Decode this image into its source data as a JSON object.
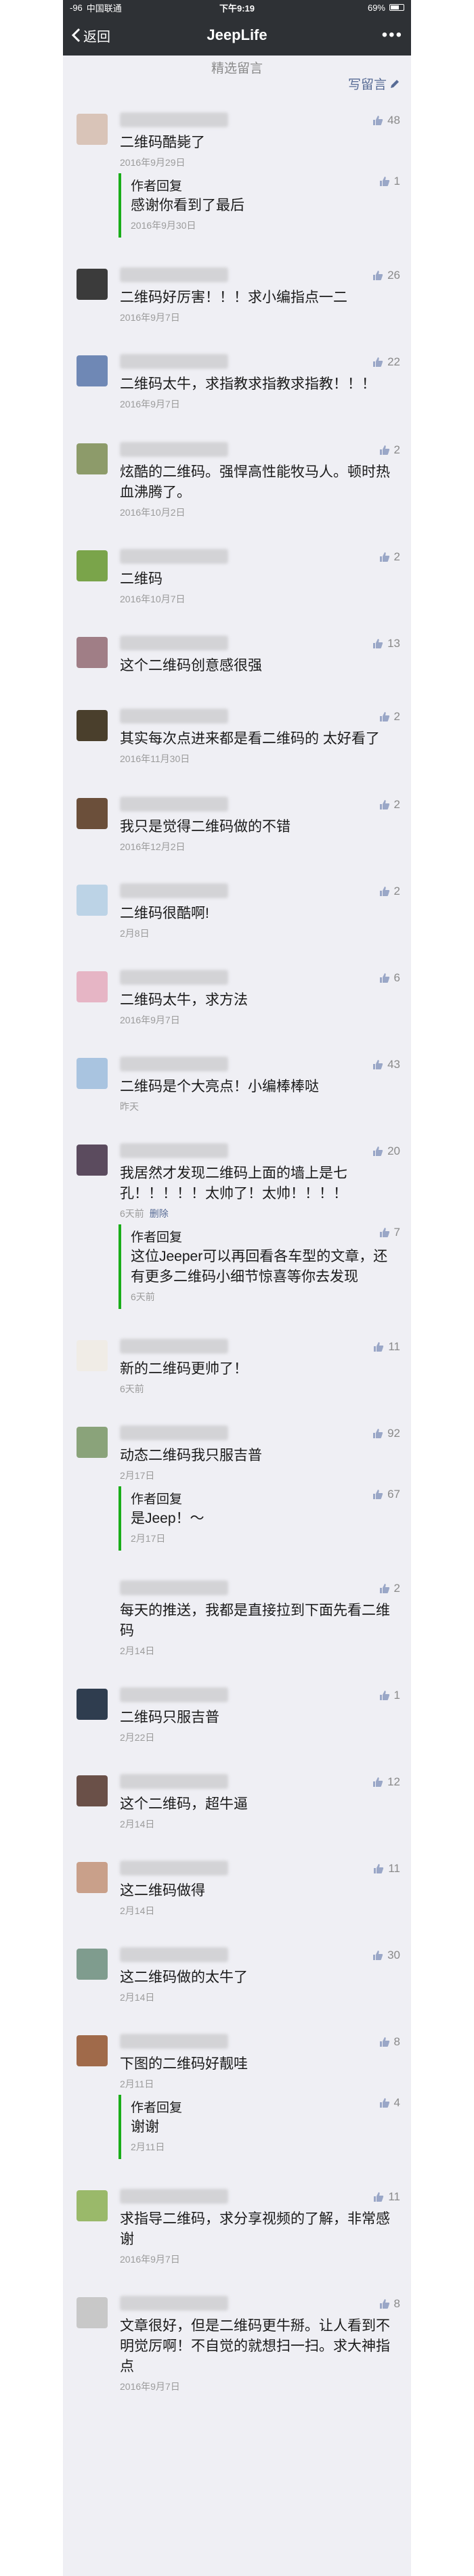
{
  "status": {
    "signal": "-96",
    "carrier": "中国联通",
    "time": "下午9:19",
    "battery": "69%"
  },
  "nav": {
    "back_label": "返回",
    "title": "JeepLife"
  },
  "section": {
    "label": "精选留言",
    "write_label": "写留言"
  },
  "reply_label": "作者回复",
  "delete_label": "删除",
  "comments": [
    {
      "text": "二维码酷毙了",
      "time": "2016年9月29日",
      "likes": "48",
      "avatar_color": "#d9c4b8",
      "reply": {
        "text": "感谢你看到了最后",
        "time": "2016年9月30日",
        "likes": "1"
      }
    },
    {
      "text": "二维码好厉害！！！求小编指点一二",
      "time": "2016年9月7日",
      "likes": "26",
      "avatar_color": "#3b3b3b"
    },
    {
      "text": "二维码太牛，求指教求指教求指教！！！",
      "time": "2016年9月7日",
      "likes": "22",
      "avatar_color": "#6f88b5"
    },
    {
      "text": "炫酷的二维码。强悍高性能牧马人。顿时热血沸腾了。",
      "time": "2016年10月2日",
      "likes": "2",
      "avatar_color": "#8d9b6a"
    },
    {
      "text": "二维码",
      "time": "2016年10月7日",
      "likes": "2",
      "avatar_color": "#7aa44a"
    },
    {
      "text": "这个二维码创意感很强",
      "time": "",
      "likes": "13",
      "avatar_color": "#a07e86"
    },
    {
      "text": "其实每次点进来都是看二维码的 太好看了",
      "time": "2016年11月30日",
      "likes": "2",
      "avatar_color": "#4a3f2c"
    },
    {
      "text": "我只是觉得二维码做的不错",
      "time": "2016年12月2日",
      "likes": "2",
      "avatar_color": "#6b4f3a"
    },
    {
      "text": "二维码很酷啊!",
      "time": "2月8日",
      "likes": "2",
      "avatar_color": "#bcd3e6"
    },
    {
      "text": "二维码太牛，求方法",
      "time": "2016年9月7日",
      "likes": "6",
      "avatar_color": "#e6b5c5"
    },
    {
      "text": "二维码是个大亮点！小编棒棒哒",
      "time": "昨天",
      "likes": "43",
      "avatar_color": "#a9c4e0"
    },
    {
      "text": "我居然才发现二维码上面的墙上是七孔！！！！！太帅了！太帅！！！！",
      "time": "6天前",
      "likes": "20",
      "avatar_color": "#5b4b5e",
      "deletable": true,
      "reply": {
        "text": "这位Jeeper可以再回看各车型的文章，还有更多二维码小细节惊喜等你去发现",
        "time": "6天前",
        "likes": "7"
      }
    },
    {
      "text": "新的二维码更帅了！",
      "time": "6天前",
      "likes": "11",
      "avatar_color": "#f0ece6"
    },
    {
      "text": "动态二维码我只服吉普",
      "time": "2月17日",
      "likes": "92",
      "avatar_color": "#8aa37a",
      "reply": {
        "text": "是Jeep！～",
        "time": "2月17日",
        "likes": "67"
      }
    },
    {
      "text": "每天的推送，我都是直接拉到下面先看二维码",
      "time": "2月14日",
      "likes": "2",
      "avatar_color": "#efeff4"
    },
    {
      "text": "二维码只服吉普",
      "time": "2月22日",
      "likes": "1",
      "avatar_color": "#2f3d4f"
    },
    {
      "text": "这个二维码，超牛逼",
      "time": "2月14日",
      "likes": "12",
      "avatar_color": "#6a5048"
    },
    {
      "text": "这二维码做得",
      "time": "2月14日",
      "likes": "11",
      "avatar_color": "#c9a08a"
    },
    {
      "text": "这二维码做的太牛了",
      "time": "2月14日",
      "likes": "30",
      "avatar_color": "#7f9c8e"
    },
    {
      "text": "下图的二维码好靓哇",
      "time": "2月11日",
      "likes": "8",
      "avatar_color": "#a06a4a",
      "reply": {
        "text": "谢谢",
        "time": "2月11日",
        "likes": "4"
      }
    },
    {
      "text": "求指导二维码，求分享视频的了解，非常感谢",
      "time": "2016年9月7日",
      "likes": "11",
      "avatar_color": "#9ab96a"
    },
    {
      "text": "文章很好，但是二维码更牛掰。让人看到不明觉厉啊！不自觉的就想扫一扫。求大神指点",
      "time": "2016年9月7日",
      "likes": "8",
      "avatar_color": "#c8c8c8"
    }
  ]
}
